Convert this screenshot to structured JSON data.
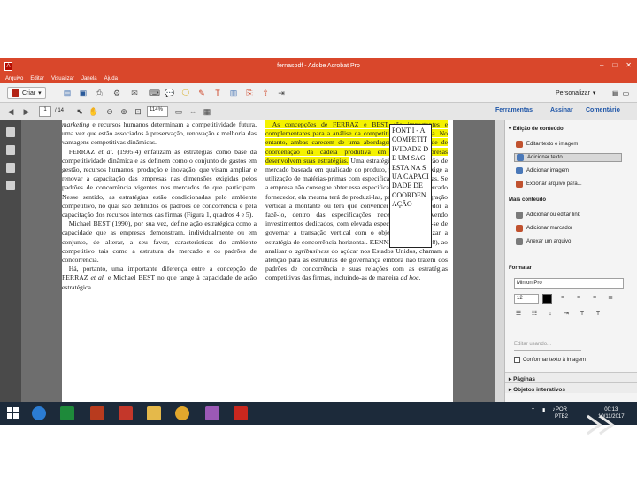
{
  "window": {
    "title": "fernaspdf - Adobe Acrobat Pro",
    "controls": [
      "–",
      "□",
      "✕"
    ]
  },
  "menu": [
    "Arquivo",
    "Editar",
    "Visualizar",
    "Janela",
    "Ajuda"
  ],
  "toolbar1": {
    "create_label": "Criar",
    "personalize_label": "Personalizar"
  },
  "toolbar2": {
    "current_page": "1",
    "total_pages": "/ 14",
    "zoom": "114%",
    "tabs": [
      "Ferramentas",
      "Assinar",
      "Comentário"
    ]
  },
  "document": {
    "left_column": [
      {
        "t": "marketing",
        "i": true
      },
      {
        "t": " e recursos humanos determinam a competitividade futura, uma vez que estão associados à preservação, renovação e melhoria das vantagens competitivas dinâmicas."
      },
      {
        "t": "\n FERRAZ "
      },
      {
        "t": "et al.",
        "i": true
      },
      {
        "t": " (1995:4) enfatizam as estratégias como base da competitividade dinâmica e as definem como o conjunto de gastos em gestão, recursos humanos, produção e inovação, que visam ampliar e renovar a capacitação das empresas nas dimensões exigidas pelos padrões de concorrência vigentes nos mercados de que participam. Nesse sentido, as estratégias estão condicionadas pelo ambiente competitivo, no qual são definidos os padrões de concorrência e pela capacitação dos recursos internos das firmas (Figura 1, quadros 4 e 5)."
      },
      {
        "t": "\n Michael BEST (1990), por sua vez, define ação estratégica como a capacidade que as empresas demonstram, individualmente ou em conjunto, de alterar, a seu favor, características do ambiente competitivo tais como a estrutura do mercado e os padrões de concorrência."
      },
      {
        "t": "\n Há, portanto, uma importante diferença entre a concepção de FERRAZ "
      },
      {
        "t": "et al.",
        "i": true
      },
      {
        "t": " e Michael BEST no que tange à capacidade de ação estratégica"
      }
    ],
    "right_highlight": " As concepções de FERRAZ e BEST são importantes e complementares para a análise da competitividade dinâmica. No entanto, ambas carecem de uma abordagem da capacidade de coordenação da cadeia produtiva em que as empresas desenvolvem suas estratégias.",
    "right_rest": [
      {
        "t": " Uma estratégia de segmentação de mercado baseada em qualidade do produto, por exemplo, exige a utilização de matérias-primas com especificações mais rígidas. Se a empresa não consegue obter essa especificação junto ao mercado fornecedor, ela mesma terá de produzi-las, por meio de integração vertical a montante ou terá que convencer algum fornecedor a fazê-lo, dentro das especificações necessárias, envolvendo investimentos dedicados, com elevada especificidade. Trata-se de governar a transação vertical com o objetivo de viabilizar a estratégia de concorrência horizontal. KENNEDY "
      },
      {
        "t": "et al.",
        "i": true
      },
      {
        "t": " (1998), ao analisar o "
      },
      {
        "t": "agribusiness",
        "i": true
      },
      {
        "t": " do açúcar nos Estados Unidos, chamam a atenção para as estruturas de governança embora não tratem dos padrões de concorrência e suas relações com as estratégias competitivas das firmas, incluindo-as de maneira "
      },
      {
        "t": "ad hoc",
        "i": true
      },
      {
        "t": "."
      }
    ],
    "note_box": "PONT I - A COMPETITIVIDADE DE UM SAG ESTA NA SUA CAPACIDADE DE COORDENAÇÃO"
  },
  "right_panel": {
    "edit_content_title": "Edição de conteúdo",
    "edit_items": [
      "Editar texto e imagem",
      "Adicionar texto",
      "Adicionar imagem",
      "Exportar arquivo para..."
    ],
    "more_content_title": "Mais conteúdo",
    "more_items": [
      "Adicionar ou editar link",
      "Adicionar marcador",
      "Anexar um arquivo"
    ],
    "format_title": "Formatar",
    "font_name": "Minion Pro",
    "font_size": "12",
    "edit_text_placeholder": "Editar usando...",
    "limit_label": "Conformar texto à imagem",
    "collapsed": [
      "Páginas",
      "Objetos interativos"
    ]
  },
  "taskbar": {
    "lang_top": "POR",
    "lang_bottom": "PTB2",
    "time": "00:13",
    "date": "10/11/2017"
  },
  "colors": {
    "acrobat_red": "#d9472b",
    "highlight": "#f4f200",
    "taskbar": "#1c2a3a"
  }
}
